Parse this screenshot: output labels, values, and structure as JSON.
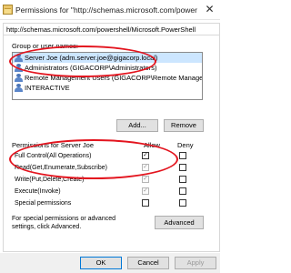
{
  "window": {
    "title": "Permissions for \"http://schemas.microsoft.com/powers...",
    "close_glyph": "✕"
  },
  "tab": {
    "label": "http://schemas.microsoft.com/powershell/Microsoft.PowerShell"
  },
  "groups": {
    "label": "Group or user names:",
    "items": [
      {
        "label": "Server Joe (adm.server.joe@gigacorp.local)",
        "selected": true
      },
      {
        "label": "Administrators (GIGACORP\\Administrators)",
        "selected": false
      },
      {
        "label": "Remote Management Users (GIGACORP\\Remote Manage...",
        "selected": false
      },
      {
        "label": "INTERACTIVE",
        "selected": false
      }
    ]
  },
  "buttons": {
    "add": "Add...",
    "remove": "Remove",
    "advanced": "Advanced",
    "ok": "OK",
    "cancel": "Cancel",
    "apply": "Apply"
  },
  "permissions": {
    "label": "Permissions for Server Joe",
    "allow_header": "Allow",
    "deny_header": "Deny",
    "rows": [
      {
        "label": "Full Control(All Operations)",
        "allow": true,
        "deny": false
      },
      {
        "label": "Read(Get,Enumerate,Subscribe)",
        "allow": false,
        "deny": false
      },
      {
        "label": "Write(Put,Delete,Create)",
        "allow": false,
        "deny": false
      },
      {
        "label": "Execute(Invoke)",
        "allow": false,
        "deny": false
      },
      {
        "label": "Special permissions",
        "allow": false,
        "deny": false
      }
    ]
  },
  "special_note": "For special permissions or advanced settings, click Advanced.",
  "annotation_color": "#e3141e"
}
